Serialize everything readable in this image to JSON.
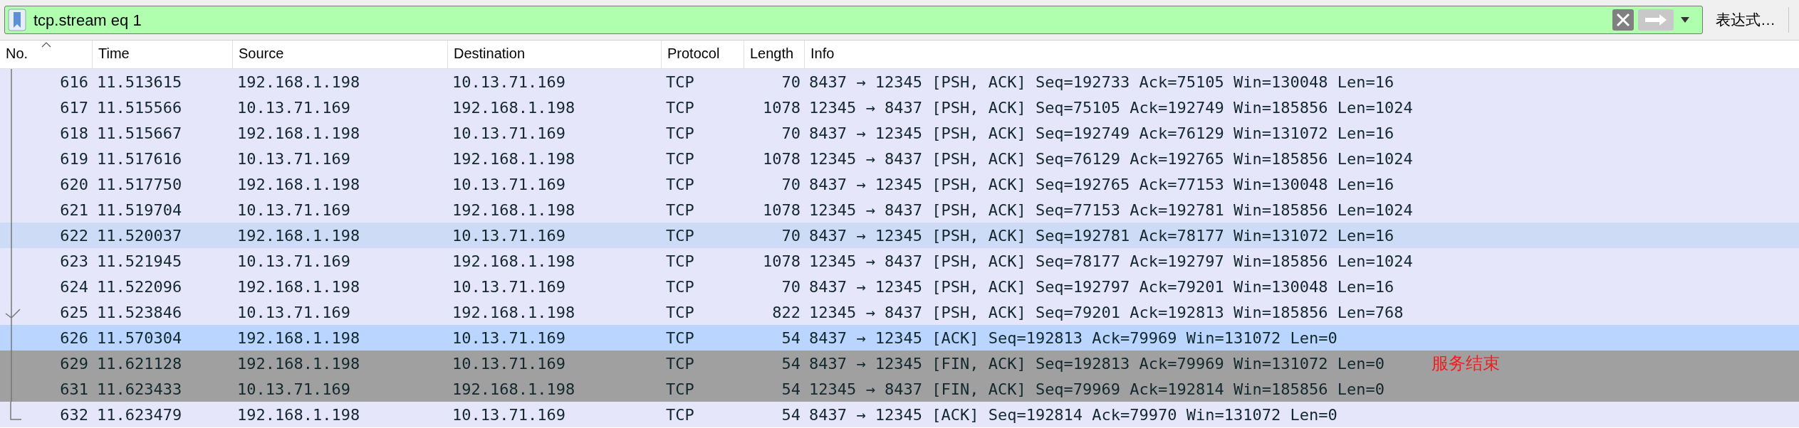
{
  "filter_bar": {
    "value": "tcp.stream eq 1",
    "expression_button": "表达式…"
  },
  "table": {
    "columns": [
      {
        "label": "No.",
        "sorted": true
      },
      {
        "label": "Time",
        "sorted": false
      },
      {
        "label": "Source",
        "sorted": false
      },
      {
        "label": "Destination",
        "sorted": false
      },
      {
        "label": "Protocol",
        "sorted": false
      },
      {
        "label": "Length",
        "sorted": false
      },
      {
        "label": "Info",
        "sorted": false
      }
    ],
    "rows": [
      {
        "kind": "line",
        "color": "#e6e6fa",
        "cells": [
          "616",
          "11.513615",
          "192.168.1.198",
          "10.13.71.169",
          "TCP",
          "70",
          "8437 → 12345 [PSH, ACK] Seq=192733 Ack=75105 Win=130048 Len=16"
        ]
      },
      {
        "kind": "line",
        "color": "#e6e6fa",
        "cells": [
          "617",
          "11.515566",
          "10.13.71.169",
          "192.168.1.198",
          "TCP",
          "1078",
          "12345 → 8437 [PSH, ACK] Seq=75105 Ack=192749 Win=185856 Len=1024"
        ]
      },
      {
        "kind": "line",
        "color": "#e6e6fa",
        "cells": [
          "618",
          "11.515667",
          "192.168.1.198",
          "10.13.71.169",
          "TCP",
          "70",
          "8437 → 12345 [PSH, ACK] Seq=192749 Ack=76129 Win=131072 Len=16"
        ]
      },
      {
        "kind": "line",
        "color": "#e6e6fa",
        "cells": [
          "619",
          "11.517616",
          "10.13.71.169",
          "192.168.1.198",
          "TCP",
          "1078",
          "12345 → 8437 [PSH, ACK] Seq=76129 Ack=192765 Win=185856 Len=1024"
        ]
      },
      {
        "kind": "line",
        "color": "#e6e6fa",
        "cells": [
          "620",
          "11.517750",
          "192.168.1.198",
          "10.13.71.169",
          "TCP",
          "70",
          "8437 → 12345 [PSH, ACK] Seq=192765 Ack=77153 Win=130048 Len=16"
        ]
      },
      {
        "kind": "line",
        "color": "#e6e6fa",
        "cells": [
          "621",
          "11.519704",
          "10.13.71.169",
          "192.168.1.198",
          "TCP",
          "1078",
          "12345 → 8437 [PSH, ACK] Seq=77153 Ack=192781 Win=185856 Len=1024"
        ]
      },
      {
        "kind": "line",
        "color": "#cddbf7",
        "cells": [
          "622",
          "11.520037",
          "192.168.1.198",
          "10.13.71.169",
          "TCP",
          "70",
          "8437 → 12345 [PSH, ACK] Seq=192781 Ack=78177 Win=131072 Len=16"
        ]
      },
      {
        "kind": "line",
        "color": "#e6e6fa",
        "cells": [
          "623",
          "11.521945",
          "10.13.71.169",
          "192.168.1.198",
          "TCP",
          "1078",
          "12345 → 8437 [PSH, ACK] Seq=78177 Ack=192797 Win=185856 Len=1024"
        ]
      },
      {
        "kind": "line",
        "color": "#e6e6fa",
        "cells": [
          "624",
          "11.522096",
          "192.168.1.198",
          "10.13.71.169",
          "TCP",
          "70",
          "8437 → 12345 [PSH, ACK] Seq=192797 Ack=79201 Win=130048 Len=16"
        ]
      },
      {
        "kind": "check",
        "color": "#e6e6fa",
        "cells": [
          "625",
          "11.523846",
          "10.13.71.169",
          "192.168.1.198",
          "TCP",
          "822",
          "12345 → 8437 [PSH, ACK] Seq=79201 Ack=192813 Win=185856 Len=768"
        ]
      },
      {
        "kind": "line",
        "color": "#bad5ff",
        "cells": [
          "626",
          "11.570304",
          "192.168.1.198",
          "10.13.71.169",
          "TCP",
          "54",
          "8437 → 12345 [ACK] Seq=192813 Ack=79969 Win=131072 Len=0"
        ]
      },
      {
        "kind": "line",
        "color": "#a0a0a0",
        "note": "服务结束",
        "cells": [
          "629",
          "11.621128",
          "192.168.1.198",
          "10.13.71.169",
          "TCP",
          "54",
          "8437 → 12345 [FIN, ACK] Seq=192813 Ack=79969 Win=131072 Len=0"
        ]
      },
      {
        "kind": "line",
        "color": "#a0a0a0",
        "cells": [
          "631",
          "11.623433",
          "10.13.71.169",
          "192.168.1.198",
          "TCP",
          "54",
          "12345 → 8437 [FIN, ACK] Seq=79969 Ack=192814 Win=185856 Len=0"
        ]
      },
      {
        "kind": "end",
        "color": "#e6e6fa",
        "cells": [
          "632",
          "11.623479",
          "192.168.1.198",
          "10.13.71.169",
          "TCP",
          "54",
          "8437 → 12345 [ACK] Seq=192814 Ack=79970 Win=131072 Len=0"
        ]
      }
    ]
  }
}
